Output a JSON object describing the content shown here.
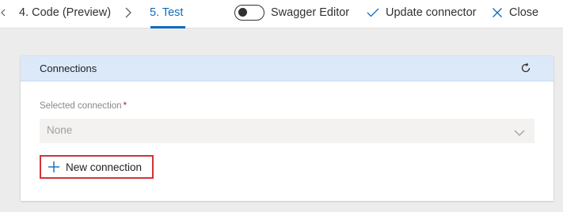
{
  "header": {
    "steps": [
      {
        "label": "4. Code (Preview)"
      },
      {
        "label": "5. Test"
      }
    ],
    "swagger_toggle": {
      "label": "Swagger Editor",
      "state": "off"
    },
    "update_label": "Update connector",
    "close_label": "Close"
  },
  "connections": {
    "title": "Connections",
    "selected_label": "Selected connection",
    "required_marker": "*",
    "selected_value": "None",
    "new_connection_label": "New connection"
  },
  "colors": {
    "accent": "#0f6cbd",
    "header_band": "#dce9f9",
    "highlight_border": "#d13438",
    "required": "#a4262c"
  },
  "icons": {
    "prev": "chevron-left-icon",
    "separator": "chevron-right-icon",
    "update": "checkmark-icon",
    "close": "close-icon",
    "refresh": "refresh-icon",
    "dropdown": "chevron-down-icon",
    "add": "plus-icon"
  }
}
